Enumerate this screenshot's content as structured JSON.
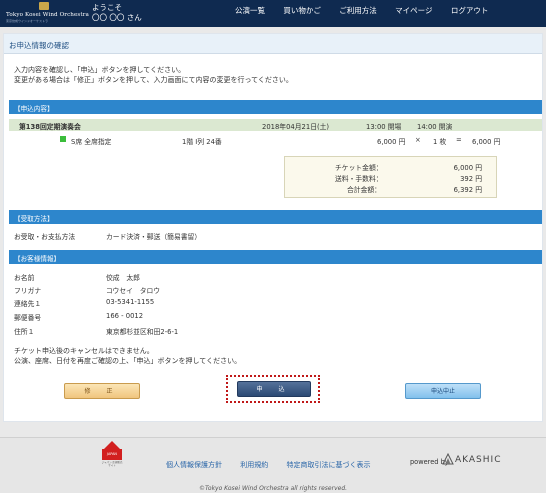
{
  "header": {
    "logo_text": "Tokyo Kosei Wind Orchestra",
    "logo_sub": "東京佼成ウインドオーケストラ",
    "welcome": "ようこそ",
    "user_name": "〇〇 〇〇 さん",
    "nav": [
      "公演一覧",
      "買い物かご",
      "ご利用方法",
      "マイページ",
      "ログアウト"
    ]
  },
  "page": {
    "title": "お申込情報の確認",
    "intro_line1": "入力内容を確認し、「申込」ボタンを押してください。",
    "intro_line2": "変更がある場合は「修正」ボタンを押して、入力画面にて内容の変更を行ってください。"
  },
  "order": {
    "section_label": "【申込内容】",
    "concert_name": "第138回定期演奏会",
    "date": "2018年04月21日(土)",
    "open_time": "13:00 開場",
    "start_time": "14:00 開演",
    "seat_class": "S席 全席指定",
    "seat_location": "1階 I列 24番",
    "unit_price": "6,000 円",
    "multiply": "×",
    "quantity": "1 枚",
    "equals": "=",
    "line_total": "6,000 円",
    "seat_color": "#3bbd3b"
  },
  "totals": {
    "ticket_label": "チケット金額：",
    "ticket_value": "6,000 円",
    "fee_label": "送料・手数料：",
    "fee_value": "392 円",
    "total_label": "合計金額：",
    "total_value": "6,392 円"
  },
  "delivery": {
    "section_label": "【受取方法】",
    "label": "お受取・お支払方法",
    "value": "カード決済・郵送（簡易書留）"
  },
  "customer": {
    "section_label": "【お客様情報】",
    "fields": [
      {
        "label": "お名前",
        "value": "佼成　太郎"
      },
      {
        "label": "フリガナ",
        "value": "コウセイ　タロウ"
      },
      {
        "label": "連絡先１",
        "value": "03-5341-1155"
      },
      {
        "label": "郵便番号",
        "value": "166 - 0012"
      },
      {
        "label": "住所１",
        "value": "東京都杉並区和田2-6-1"
      }
    ]
  },
  "notes": {
    "line1": "チケット申込後のキャンセルはできません。",
    "line2": "公演、座席、日付を再度ご確認の上、「申込」ボタンを押してください。"
  },
  "buttons": {
    "edit": "修 正",
    "apply": "申 込",
    "cancel": "申込中止"
  },
  "footer": {
    "seal_badge": "JAPAN",
    "seal_text": "ジャパン\n正規販売サイト",
    "links": [
      "個人情報保護方針",
      "利用規約",
      "特定商取引法に基づく表示"
    ],
    "powered_by": "powered by",
    "brand": "AKASHIC",
    "copyright": "©Tokyo Kosei Wind Orchestra all rights reserved."
  },
  "colors": {
    "header_bg": "#0f2a50",
    "section_bg": "#2d86cc",
    "concert_row_bg": "#dbe8d1",
    "apply_focus": "#c01818"
  }
}
